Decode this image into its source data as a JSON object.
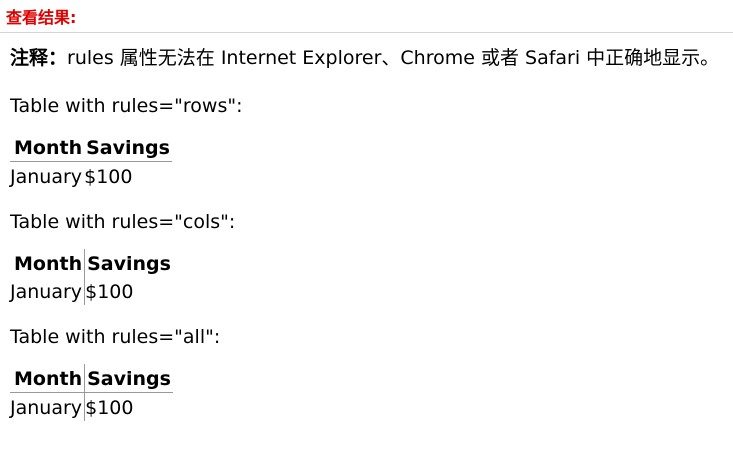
{
  "header": {
    "title": "查看结果:"
  },
  "note": {
    "label": "注释：",
    "text": "rules 属性无法在 Internet Explorer、Chrome 或者 Safari 中正确地显示。"
  },
  "tables": [
    {
      "caption": "Table with rules=\"rows\":",
      "headers": [
        "Month",
        "Savings"
      ],
      "row": [
        "January",
        "$100"
      ]
    },
    {
      "caption": "Table with rules=\"cols\":",
      "headers": [
        "Month",
        "Savings"
      ],
      "row": [
        "January",
        "$100"
      ]
    },
    {
      "caption": "Table with rules=\"all\":",
      "headers": [
        "Month",
        "Savings"
      ],
      "row": [
        "January",
        "$100"
      ]
    }
  ]
}
